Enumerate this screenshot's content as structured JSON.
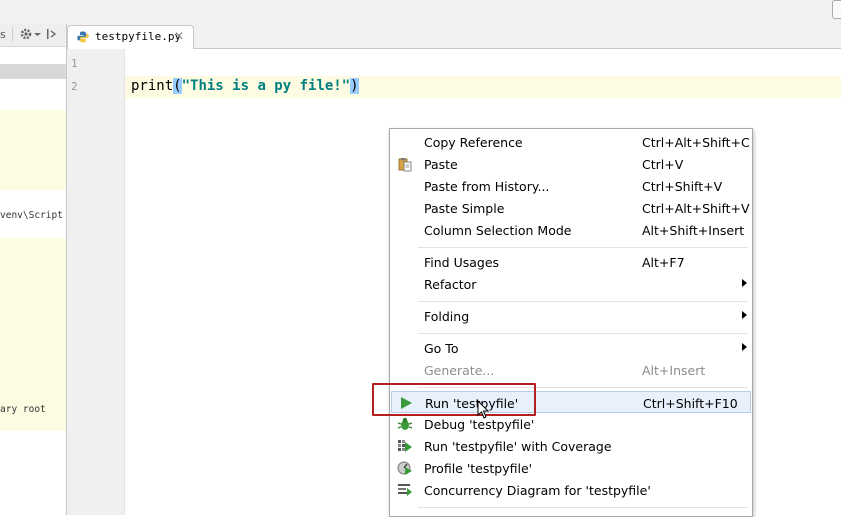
{
  "left_panel": {
    "toolbar_partial": "s",
    "texts": [
      "venv\\Script",
      "ary root"
    ]
  },
  "editor": {
    "tab": {
      "label": "testpyfile.py"
    },
    "line_numbers": [
      "1",
      "2"
    ],
    "code": {
      "fn": "print",
      "open": "(",
      "string": "\"This is a py file!\"",
      "close": ")"
    }
  },
  "context_menu": {
    "items": [
      {
        "label": "Copy Reference",
        "shortcut": "Ctrl+Alt+Shift+C"
      },
      {
        "label": "Paste",
        "shortcut": "Ctrl+V",
        "icon": "paste-icon"
      },
      {
        "label": "Paste from History...",
        "shortcut": "Ctrl+Shift+V"
      },
      {
        "label": "Paste Simple",
        "shortcut": "Ctrl+Alt+Shift+V"
      },
      {
        "label": "Column Selection Mode",
        "shortcut": "Alt+Shift+Insert"
      },
      {
        "label": "Find Usages",
        "shortcut": "Alt+F7"
      },
      {
        "label": "Refactor",
        "submenu": true
      },
      {
        "label": "Folding",
        "submenu": true
      },
      {
        "label": "Go To",
        "submenu": true
      },
      {
        "label": "Generate...",
        "shortcut": "Alt+Insert",
        "disabled": true
      },
      {
        "label": "Run 'testpyfile'",
        "shortcut": "Ctrl+Shift+F10",
        "icon": "run-icon",
        "hover": true
      },
      {
        "label": "Debug 'testpyfile'",
        "icon": "debug-icon"
      },
      {
        "label": "Run 'testpyfile' with Coverage",
        "icon": "coverage-icon"
      },
      {
        "label": "Profile 'testpyfile'",
        "icon": "profile-icon"
      },
      {
        "label": "Concurrency Diagram for 'testpyfile'",
        "icon": "concurrency-icon"
      }
    ]
  },
  "colors": {
    "caret_line": "#fdfbe1",
    "string": "#008080",
    "highlight_box": "#b41e1e",
    "run_green": "#3a9a3a"
  }
}
